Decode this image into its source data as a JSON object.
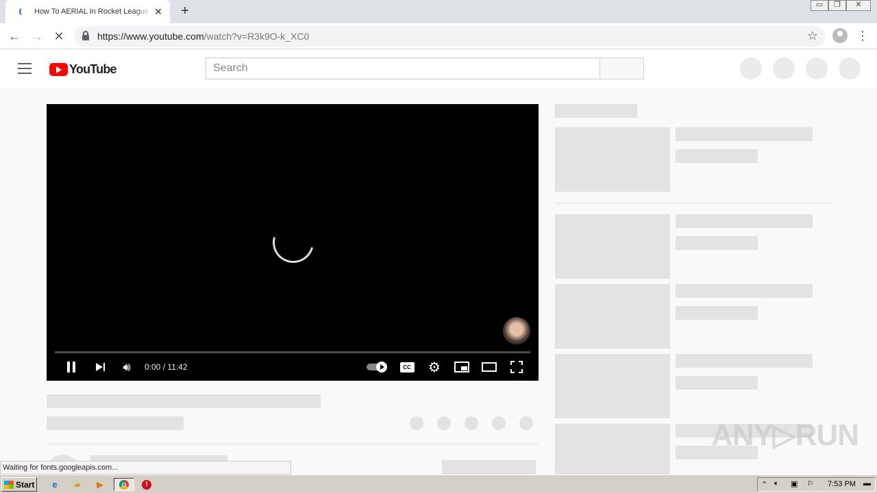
{
  "browser": {
    "tab_title": "How To AERIAL In Rocket League fr",
    "tab_close": "✕",
    "new_tab": "+",
    "url_domain": "https://www.youtube.com",
    "url_path": "/watch?v=R3k9O-k_XC0",
    "window_min": "▭",
    "window_restore": "❐",
    "window_close": "✕"
  },
  "youtube": {
    "logo_text": "YouTube",
    "search_placeholder": "Search"
  },
  "player": {
    "time": "0:00 / 11:42",
    "cc_label": "CC"
  },
  "status_bar": "Waiting for fonts.googleapis.com...",
  "watermark": "ANY▷RUN",
  "taskbar": {
    "start_label": "Start",
    "clock": "7:53 PM"
  }
}
